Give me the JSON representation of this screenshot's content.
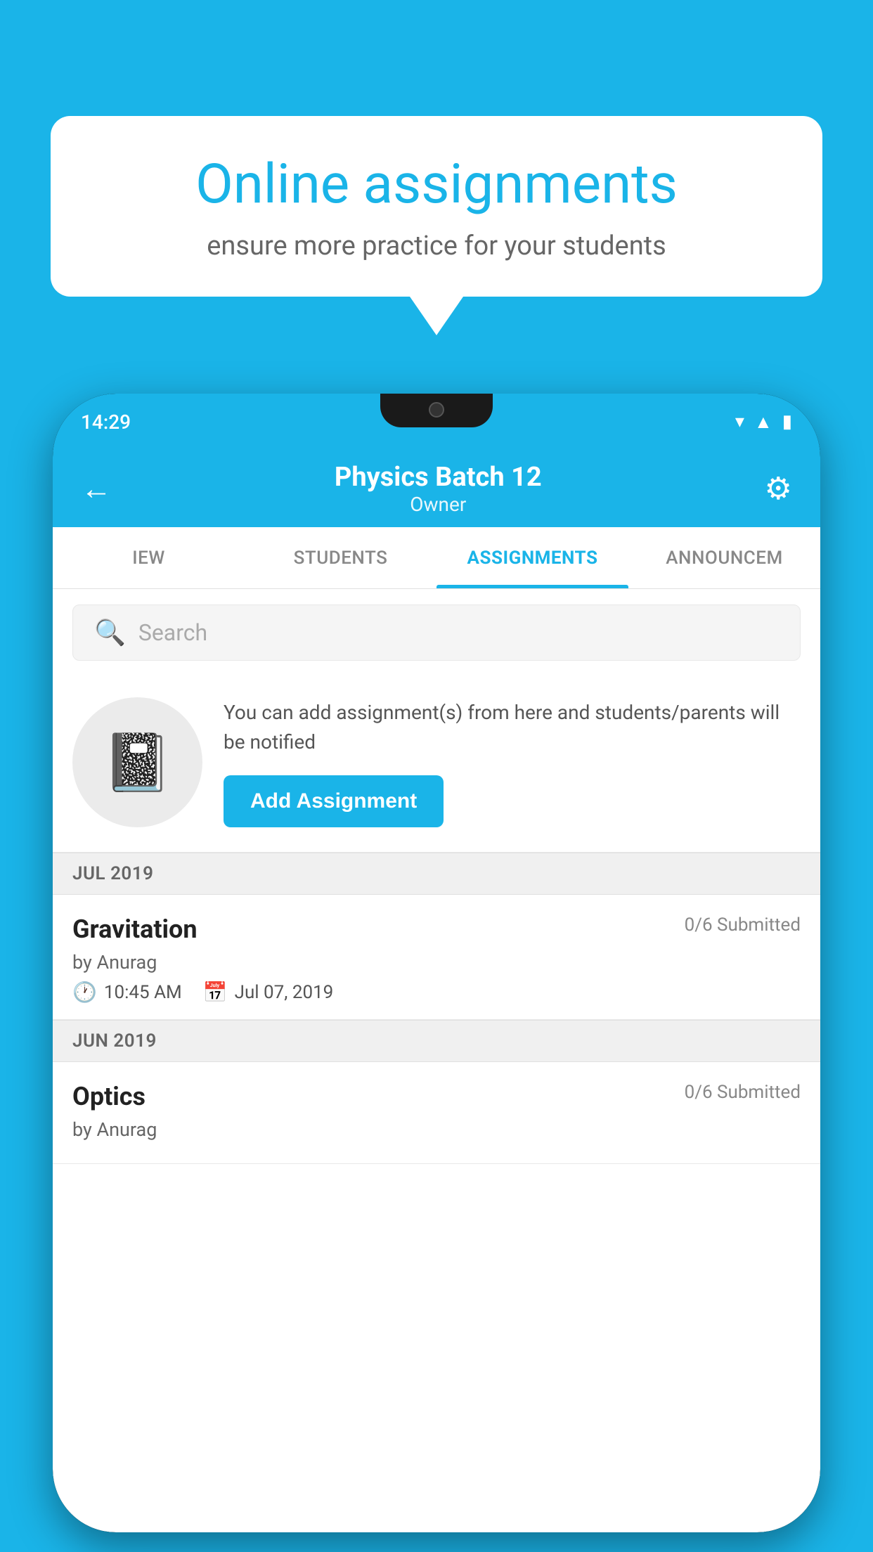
{
  "background_color": "#1ab4e8",
  "speech_bubble": {
    "title": "Online assignments",
    "subtitle": "ensure more practice for your students"
  },
  "phone": {
    "time": "14:29",
    "header": {
      "title": "Physics Batch 12",
      "subtitle": "Owner",
      "back_label": "←",
      "settings_label": "⚙"
    },
    "tabs": [
      {
        "label": "IEW",
        "active": false
      },
      {
        "label": "STUDENTS",
        "active": false
      },
      {
        "label": "ASSIGNMENTS",
        "active": true
      },
      {
        "label": "ANNOUNCEM",
        "active": false
      }
    ],
    "search": {
      "placeholder": "Search"
    },
    "info_box": {
      "text": "You can add assignment(s) from here and students/parents will be notified",
      "button_label": "Add Assignment"
    },
    "sections": [
      {
        "label": "JUL 2019",
        "assignments": [
          {
            "title": "Gravitation",
            "submitted": "0/6 Submitted",
            "by": "by Anurag",
            "time": "10:45 AM",
            "date": "Jul 07, 2019"
          }
        ]
      },
      {
        "label": "JUN 2019",
        "assignments": [
          {
            "title": "Optics",
            "submitted": "0/6 Submitted",
            "by": "by Anurag",
            "time": "",
            "date": ""
          }
        ]
      }
    ]
  }
}
